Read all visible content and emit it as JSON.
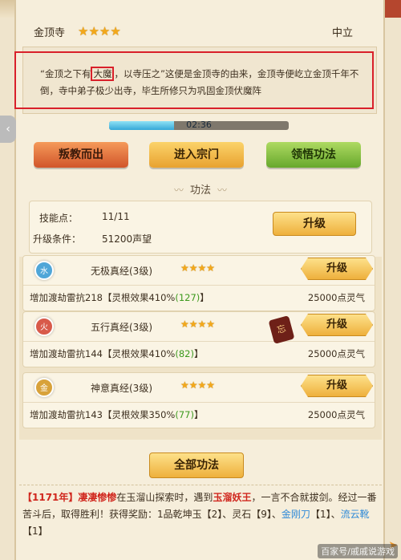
{
  "header": {
    "sect_name": "金顶寺",
    "stars": "★★★★",
    "alignment": "中立"
  },
  "description": {
    "part1": "“金顶之下有",
    "highlight": "大魔",
    "part2": "，以寺压之”这便是金顶寺的由来，金顶寺便屹立金顶千年不倒，寺中弟子极少出寺，毕生所修只为巩固金顶伏魔阵"
  },
  "timer": {
    "text": "02:36",
    "fill_fraction": 0.36
  },
  "actions": {
    "betray": "叛教而出",
    "enter": "进入宗门",
    "learn": "领悟功法"
  },
  "section": {
    "title": "功法"
  },
  "skill_panel": {
    "points_label": "技能点：",
    "points_value": "11/11",
    "condition_label": "升级条件：",
    "condition_value": "51200声望",
    "upgrade": "升级"
  },
  "skills": [
    {
      "icon_text": "水",
      "icon_color": "#4fa6d8",
      "name": "无极真经(3级)",
      "stars": "★★★★",
      "upgrade": "升级",
      "effect_pre": "增加渡劫雷抗218【灵根效果410%",
      "effect_num": "(127)",
      "effect_post": "】",
      "cost": "25000点灵气"
    },
    {
      "icon_text": "火",
      "icon_color": "#d85a4a",
      "name": "五行真经(3级)",
      "stars": "★★★★",
      "upgrade": "升级",
      "effect_pre": "增加渡劫雷抗144【灵根效果410%",
      "effect_num": "(82)",
      "effect_post": "】",
      "cost": "25000点灵气"
    },
    {
      "icon_text": "金",
      "icon_color": "#d8a23a",
      "name": "神意真经(3级)",
      "stars": "★★★★",
      "upgrade": "升级",
      "effect_pre": "增加渡劫雷抗143【灵根效果350%",
      "effect_num": "(77)",
      "effect_post": "】",
      "cost": "25000点灵气"
    }
  ],
  "tag_icon_text": "忘",
  "all_skills_button": "全部功法",
  "log": {
    "year": "【1171年】",
    "actor": "凄凄惨惨",
    "t1": "在玉溜山探索时，遇到",
    "enemy": "玉溜妖王",
    "t2": "，一言不合就拔剑。经过一番苦斗后，取得胜利！获得奖励：1品乾坤玉【2】、灵石【9】、",
    "item1": "金刚刀",
    "t3": "【1】、",
    "item2": "流云靴",
    "t4": "【1】"
  },
  "watermark": "百家号/戚戚说游戏",
  "close_icon": "close-icon"
}
